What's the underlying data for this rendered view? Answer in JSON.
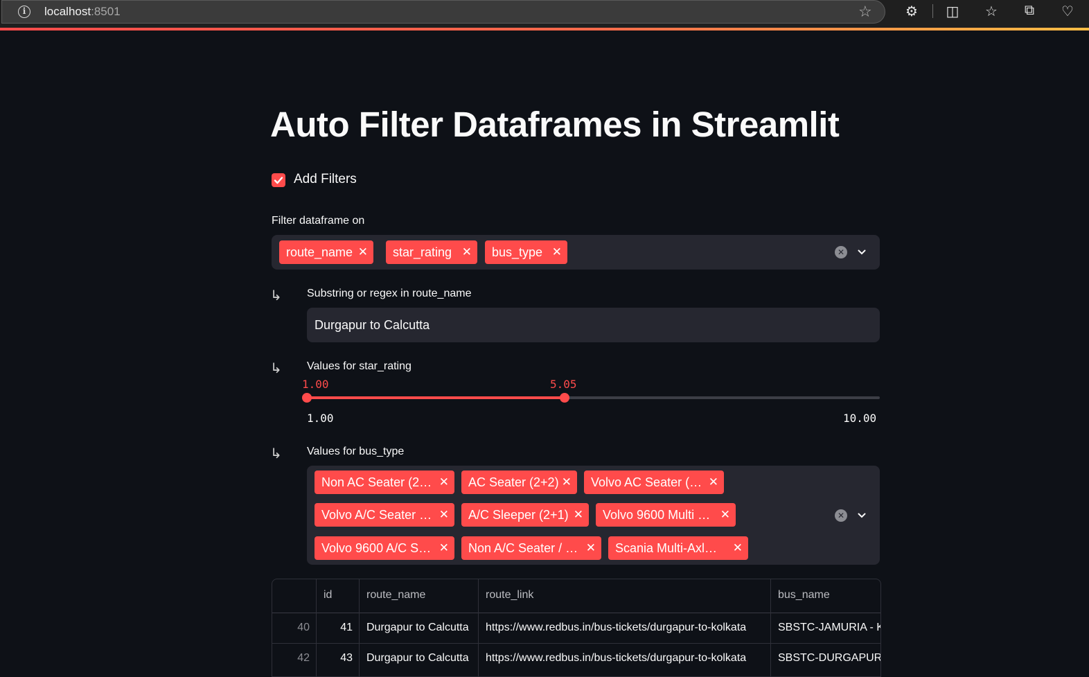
{
  "browser": {
    "url_host": "localhost",
    "url_port": ":8501"
  },
  "page": {
    "title": "Auto Filter Dataframes in Streamlit"
  },
  "add_filters": {
    "label": "Add Filters",
    "checked": true
  },
  "filter_on": {
    "label": "Filter dataframe on",
    "tags": [
      "route_name",
      "star_rating",
      "bus_type"
    ]
  },
  "route_filter": {
    "arrow": "↳",
    "label": "Substring or regex in route_name",
    "value": "Durgapur to Calcutta"
  },
  "star_filter": {
    "arrow": "↳",
    "label": "Values for star_rating",
    "low": "1.00",
    "high": "5.05",
    "min": "1.00",
    "max": "10.00"
  },
  "bus_filter": {
    "arrow": "↳",
    "label": "Values for bus_type",
    "tags": [
      "Non AC Seater (2…",
      "AC Seater (2+2)",
      "Volvo AC Seater (…",
      "Volvo A/C Seater …",
      "A/C Sleeper (2+1)",
      "Volvo 9600 Multi …",
      "Volvo 9600 A/C S…",
      "Non A/C Seater / …",
      "Scania Multi-Axl…"
    ]
  },
  "dataframe": {
    "columns": [
      "",
      "id",
      "route_name",
      "route_link",
      "bus_name"
    ],
    "rows": [
      [
        "40",
        "41",
        "Durgapur to Calcutta",
        "https://www.redbus.in/bus-tickets/durgapur-to-kolkata",
        "SBSTC-JAMURIA - KO"
      ],
      [
        "42",
        "43",
        "Durgapur to Calcutta",
        "https://www.redbus.in/bus-tickets/durgapur-to-kolkata",
        "SBSTC-DURGAPUR - "
      ]
    ]
  },
  "colors": {
    "accent": "#ff4b4b",
    "background": "#0e1117",
    "widget_bg": "#262730"
  }
}
